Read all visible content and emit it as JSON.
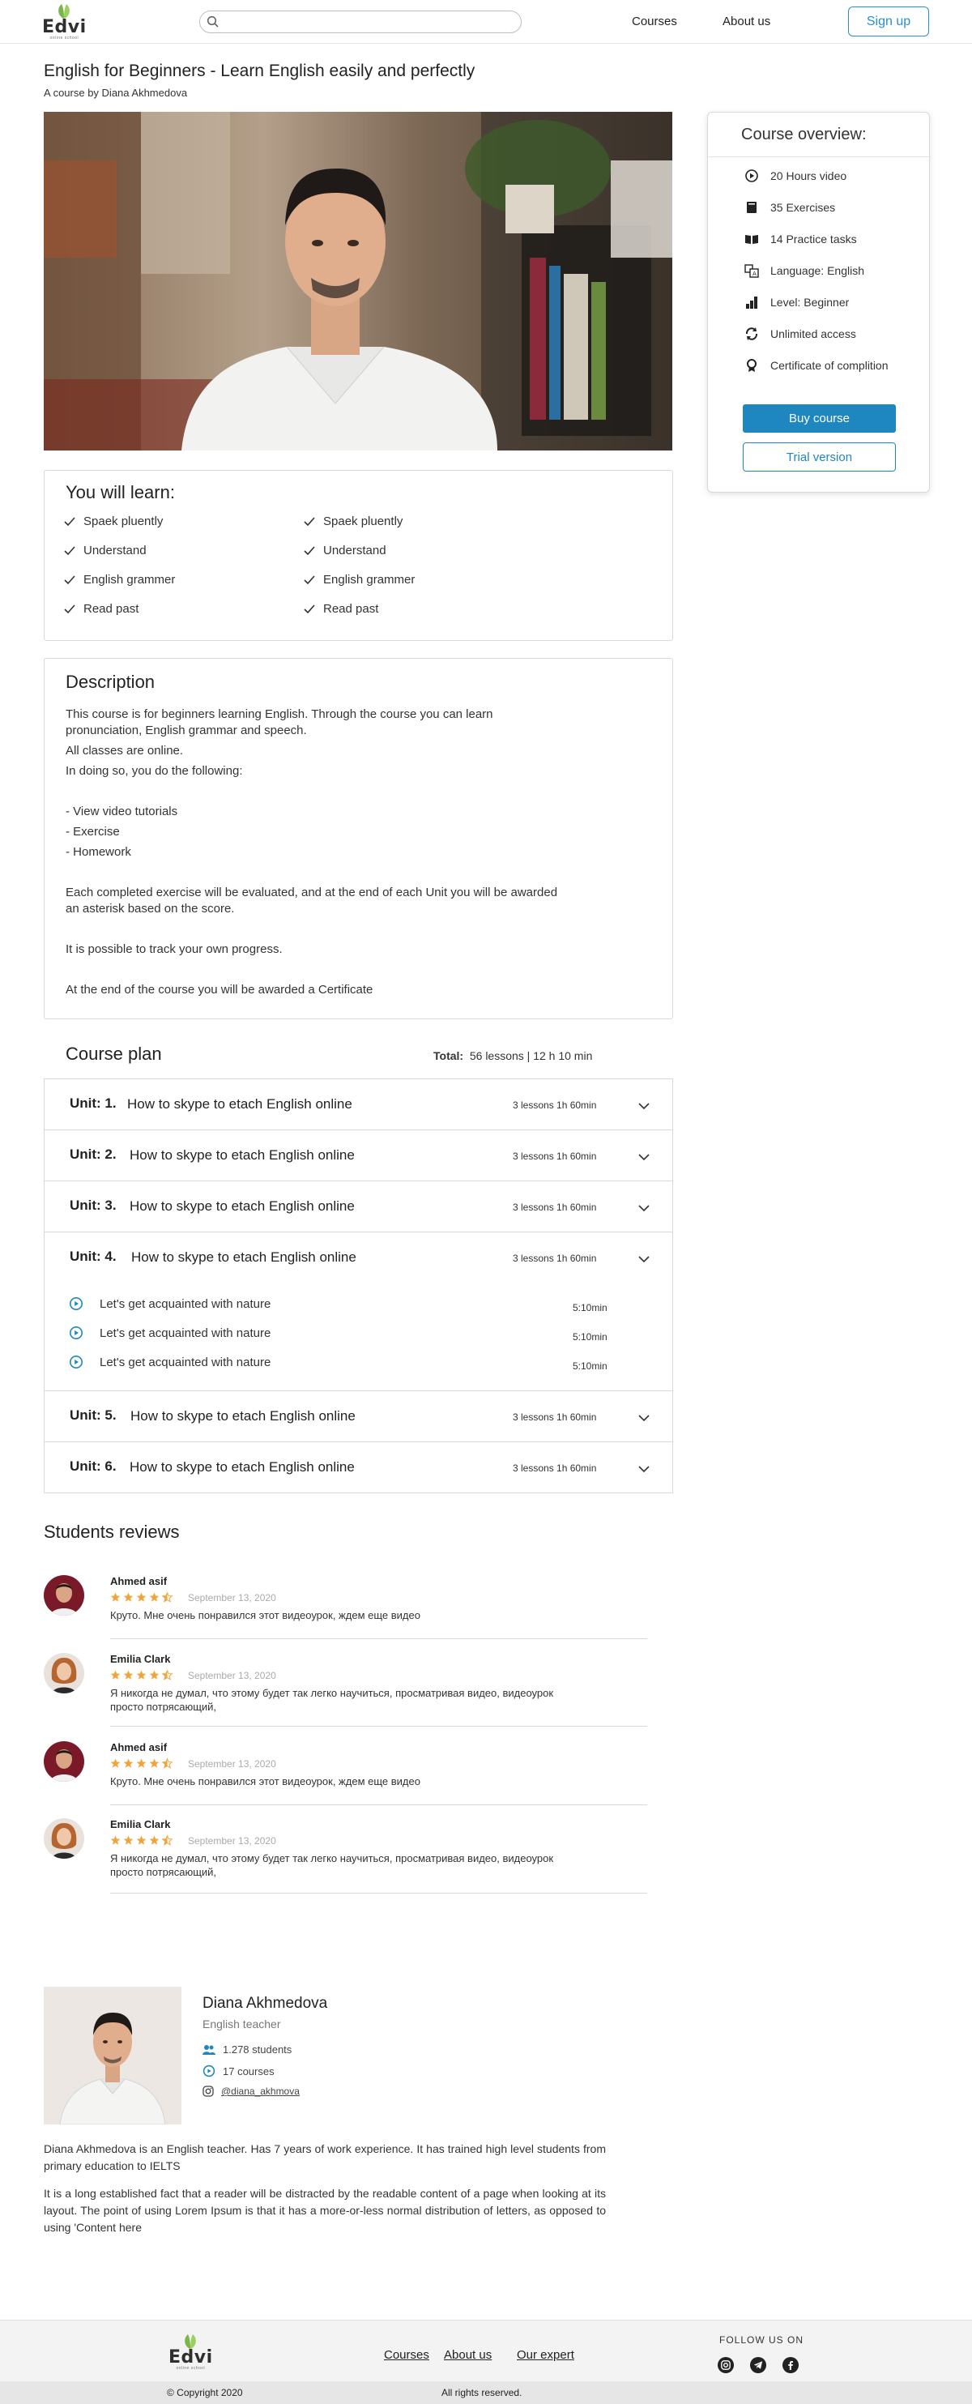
{
  "header": {
    "logo": "Edvi",
    "logo_sub": "online school",
    "search_placeholder": "",
    "nav": [
      "Courses",
      "About us"
    ],
    "signup": "Sign up"
  },
  "course": {
    "title": "English for Beginners - Learn English easily and perfectly",
    "byline": "A course by Diana Akhmedova"
  },
  "overview": {
    "title": "Course overview:",
    "items": [
      {
        "icon": "play-circle-icon",
        "label": "20 Hours video"
      },
      {
        "icon": "book-icon",
        "label": "35 Exercises"
      },
      {
        "icon": "open-book-icon",
        "label": "14 Practice tasks"
      },
      {
        "icon": "translate-icon",
        "label": "Language: English"
      },
      {
        "icon": "bar-chart-icon",
        "label": "Level: Beginner"
      },
      {
        "icon": "infinity-refresh-icon",
        "label": "Unlimited access"
      },
      {
        "icon": "certificate-icon",
        "label": "Certificate of complition"
      }
    ],
    "buy": "Buy course",
    "trial": "Trial version"
  },
  "learn": {
    "title": "You will learn:",
    "left": [
      "Spaek  pluently",
      "Understand",
      "English grammer",
      "Read past"
    ],
    "right": [
      "Spaek  pluently",
      "Understand",
      "English grammer",
      "Read past"
    ]
  },
  "description": {
    "title": "Description",
    "p1": "This course is for beginners learning English.  Through the course you can learn",
    "p2": "pronunciation, English grammar and speech.",
    "p3": "All classes are online.",
    "p4": "In doing so, you do the following:",
    "p5": "- View video tutorials",
    "p6": "- Exercise",
    "p7": "- Homework",
    "p8": "Each completed exercise will be evaluated, and at the end of each Unit you will be awarded",
    "p9": "an asterisk based on the score.",
    "p10": "It is possible to track your own progress.",
    "p11": "At the end of the course you will be awarded a Certificate"
  },
  "plan": {
    "title": "Course plan",
    "total_label": "Total:",
    "total_value": "56 lessons  |  12 h 10 min",
    "units": [
      {
        "label": "Unit:  1.",
        "title": "How to skype to etach English online",
        "meta": "3 lessons   1h   60min"
      },
      {
        "label": "Unit:  2.",
        "title": "How to skype to etach English online",
        "meta": "3 lessons   1h   60min"
      },
      {
        "label": "Unit:  3.",
        "title": "How to skype to etach English online",
        "meta": "3 lessons   1h   60min"
      },
      {
        "label": "Unit:  4.",
        "title": "How to skype to etach English online",
        "meta": "3 lessons   1h   60min"
      },
      {
        "label": "Unit:  5.",
        "title": "How to skype to etach English online",
        "meta": "3 lessons   1h   60min"
      },
      {
        "label": "Unit:  6.",
        "title": "How to skype to etach English online",
        "meta": "3 lessons   1h   60min"
      }
    ],
    "lessons": [
      {
        "title": "Let's get acquainted with nature",
        "time": "5:10min"
      },
      {
        "title": "Let's get acquainted with nature",
        "time": "5:10min"
      },
      {
        "title": "Let's get acquainted with nature",
        "time": "5:10min"
      }
    ]
  },
  "reviews": {
    "title": "Students reviews",
    "items": [
      {
        "name": "Ahmed asif",
        "date": "September 13, 2020",
        "rating": 4.5,
        "text": "Круто. Мне очень понравился этот видеоурок, ждем еще видео"
      },
      {
        "name": "Emilia Clark",
        "date": "September 13, 2020",
        "rating": 4.5,
        "text": "Я никогда не думал, что этому будет так легко научиться, просматривая видео, видеоурок просто потрясающий,"
      },
      {
        "name": "Ahmed asif",
        "date": "September 13, 2020",
        "rating": 4.5,
        "text": "Круто. Мне очень понравился этот видеоурок, ждем еще видео"
      },
      {
        "name": "Emilia Clark",
        "date": "September 13, 2020",
        "rating": 4.5,
        "text": "Я никогда не думал, что этому будет так легко научиться, просматривая видео, видеоурок просто потрясающий,"
      }
    ]
  },
  "teacher": {
    "name": "Diana Akhmedova",
    "role": "English teacher",
    "students": "1.278 students",
    "courses": "17 courses",
    "instagram": "@diana_akhmova",
    "bio1": "Diana Akhmedova is an English teacher. Has 7 years of work experience. It has trained high level students from primary education to IELTS",
    "bio2": "It is a long established fact that a reader will be distracted by the readable content of a page when looking at its layout. The point of using Lorem Ipsum is that it has a more-or-less normal distribution of letters, as opposed to using 'Content here"
  },
  "footer": {
    "links": [
      "Courses",
      "About us",
      "Our expert"
    ],
    "follow": "FOLLOW US ON",
    "social": [
      "instagram-icon",
      "telegram-icon",
      "facebook-icon"
    ],
    "copyright": "© Copyright 2020",
    "rights": "All rights reserved."
  },
  "colors": {
    "accent": "#1f87c0",
    "star": "#f2a33a",
    "logo_green": "#7ab648"
  }
}
